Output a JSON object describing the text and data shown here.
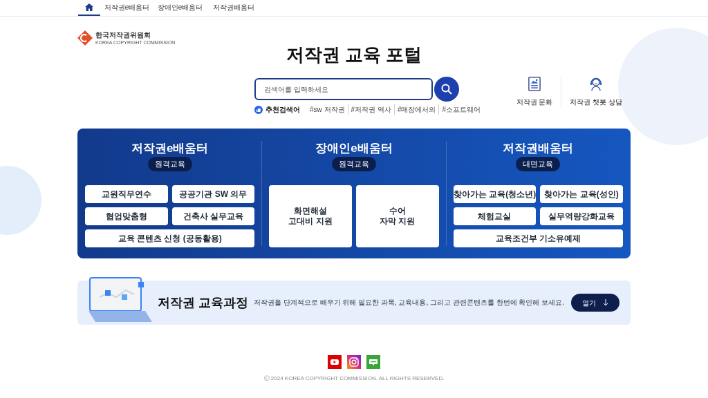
{
  "nav": {
    "items": [
      {
        "kind": "home",
        "selected": true
      },
      {
        "kind": "link",
        "label": "저작권e배움터",
        "selected": false
      },
      {
        "kind": "link",
        "label": "장애인e배움터",
        "selected": false
      },
      {
        "kind": "link",
        "label": "저작권배움터",
        "selected": false
      }
    ]
  },
  "logo": {
    "name": "한국저작권위원회",
    "subtitle": "KOREA COPYRIGHT COMMISSION"
  },
  "title": "저작권 교육 포털",
  "search": {
    "placeholder": "검색어를 입력하세요"
  },
  "recommended": {
    "label": "추천검색어",
    "tags": [
      "#sw 저작권",
      "#저작권 역사",
      "#매장에서의",
      "#소프트웨어"
    ]
  },
  "quick_links": [
    {
      "kind": "document",
      "label": "저작권 문화"
    },
    {
      "kind": "chatbot",
      "label": "저작권 챗봇 상담"
    }
  ],
  "sections": [
    {
      "title": "저작권e배움터",
      "badge": "원격교육",
      "buttons": [
        {
          "label": "교원직무연수",
          "kind": "small"
        },
        {
          "label": "공공기관 SW 의무",
          "kind": "small"
        },
        {
          "label": "협업맞춤형",
          "kind": "small"
        },
        {
          "label": "건축사 실무교육",
          "kind": "small"
        },
        {
          "label": "교육 콘텐츠 신청 (공동활용)",
          "kind": "wide"
        }
      ]
    },
    {
      "title": "장애인e배움터",
      "badge": "원격교육",
      "buttons": [
        {
          "label": "화면해설\n고대비 지원",
          "kind": "tall"
        },
        {
          "label": "수어\n자막 지원",
          "kind": "tall"
        }
      ]
    },
    {
      "title": "저작권배움터",
      "badge": "대면교육",
      "buttons": [
        {
          "label": "찾아가는 교육(청소년)",
          "kind": "small"
        },
        {
          "label": "찾아가는 교육(성인)",
          "kind": "small"
        },
        {
          "label": "체험교실",
          "kind": "small"
        },
        {
          "label": "실무역량강화교육",
          "kind": "small"
        },
        {
          "label": "교육조건부 기소유예제",
          "kind": "wide"
        }
      ]
    }
  ],
  "course": {
    "title": "저작권 교육과정",
    "description": "저작권을 단계적으로 배우기 위해 필요한 과목, 교육내용, 그리고 관련콘텐츠를 한번에 확인해 보세요.",
    "button": "열기"
  },
  "social": [
    {
      "kind": "youtube"
    },
    {
      "kind": "instagram"
    },
    {
      "kind": "blog"
    }
  ],
  "copyright": "ⓒ 2024 KOREA COPYRIGHT COMMISSION. ALL RIGHTS RESERVED."
}
